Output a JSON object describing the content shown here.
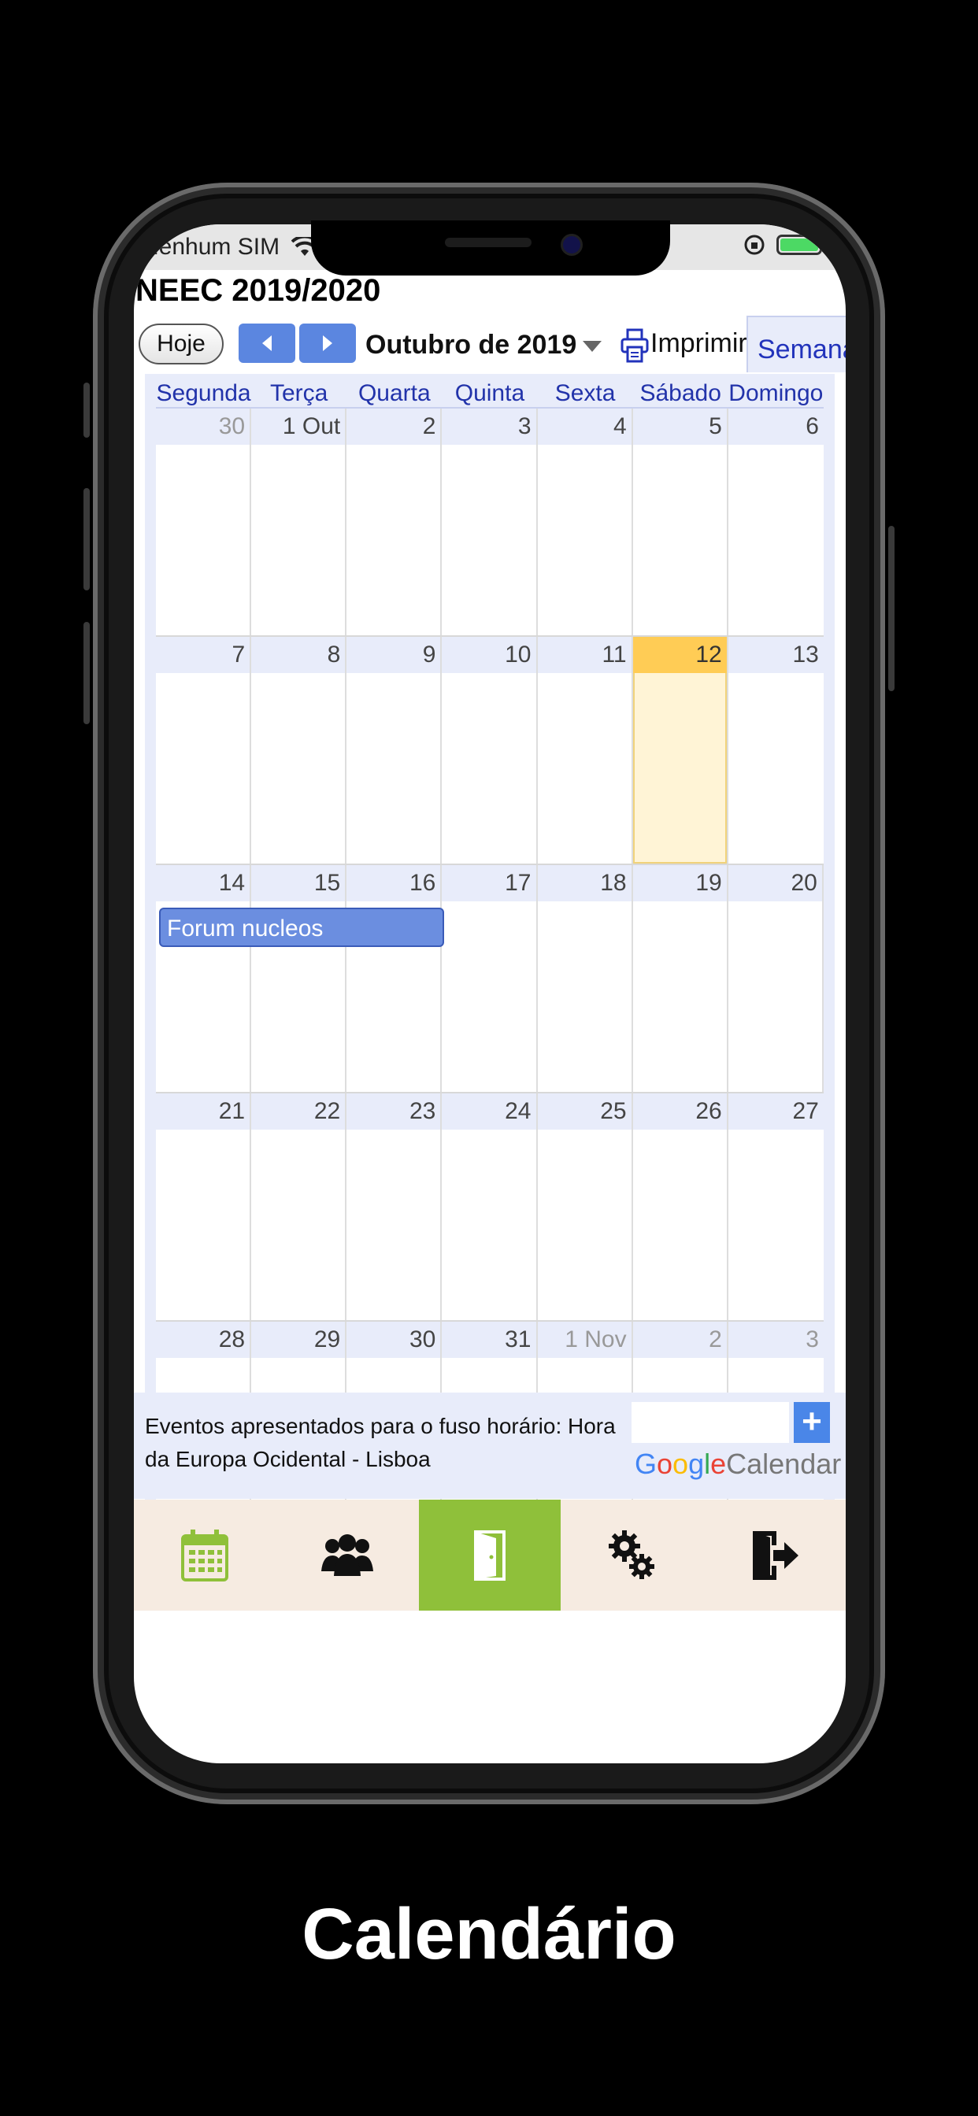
{
  "status_bar": {
    "carrier": "Nenhum SIM",
    "battery_level": 1.0
  },
  "app": {
    "title": "NEEC 2019/2020"
  },
  "toolbar": {
    "today_label": "Hoje",
    "month_label": "Outubro de 2019",
    "print_label": "Imprimir",
    "view_tab_label": "Semana"
  },
  "calendar": {
    "weekdays": [
      "Segunda",
      "Terça",
      "Quarta",
      "Quinta",
      "Sexta",
      "Sábado",
      "Domingo"
    ],
    "weeks": [
      [
        {
          "n": "30",
          "other": true
        },
        {
          "n": "1 Out"
        },
        {
          "n": "2"
        },
        {
          "n": "3"
        },
        {
          "n": "4"
        },
        {
          "n": "5"
        },
        {
          "n": "6"
        }
      ],
      [
        {
          "n": "7"
        },
        {
          "n": "8"
        },
        {
          "n": "9"
        },
        {
          "n": "10"
        },
        {
          "n": "11"
        },
        {
          "n": "12",
          "today": true
        },
        {
          "n": "13"
        }
      ],
      [
        {
          "n": "14"
        },
        {
          "n": "15"
        },
        {
          "n": "16"
        },
        {
          "n": "17"
        },
        {
          "n": "18"
        },
        {
          "n": "19"
        },
        {
          "n": "20"
        }
      ],
      [
        {
          "n": "21"
        },
        {
          "n": "22"
        },
        {
          "n": "23"
        },
        {
          "n": "24"
        },
        {
          "n": "25"
        },
        {
          "n": "26"
        },
        {
          "n": "27"
        }
      ],
      [
        {
          "n": "28"
        },
        {
          "n": "29"
        },
        {
          "n": "30"
        },
        {
          "n": "31"
        },
        {
          "n": "1 Nov",
          "other": true
        },
        {
          "n": "2",
          "other": true
        },
        {
          "n": "3",
          "other": true
        }
      ]
    ],
    "events": [
      {
        "title": "Forum nucleos",
        "week": 2
      }
    ]
  },
  "footer": {
    "timezone_text": "Eventos apresentados para o fuso horário: Hora da Europa Ocidental - Lisboa",
    "plus_label": "+",
    "google_letters": [
      "G",
      "o",
      "o",
      "g",
      "l",
      "e"
    ],
    "calendar_word": "Calendar"
  },
  "tabbar": {
    "items": [
      {
        "icon": "calendar-icon",
        "active": false
      },
      {
        "icon": "group-icon",
        "active": false
      },
      {
        "icon": "door-icon",
        "active": true
      },
      {
        "icon": "gears-icon",
        "active": false
      },
      {
        "icon": "logout-icon",
        "active": false
      }
    ],
    "active_color": "#8fc03a",
    "background_color": "#f6ebe1"
  },
  "caption": "Calendário"
}
